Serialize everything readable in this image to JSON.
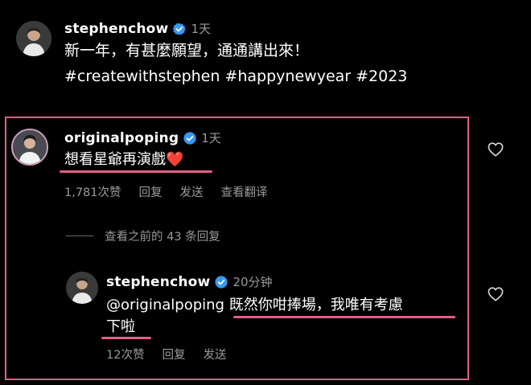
{
  "post": {
    "username": "stephenchow",
    "time": "1天",
    "caption_line1": "新一年，有甚麼願望，通通講出來！",
    "caption_line2": "#createwithstephen #happynewyear #2023"
  },
  "comment": {
    "username": "originalpoping",
    "time": "1天",
    "text": "想看星爺再演戲",
    "emoji": "❤️",
    "likes": "1,781次赞",
    "reply_label": "回复",
    "send_label": "发送",
    "translate_label": "查看翻译",
    "view_previous": "查看之前的 43 条回复"
  },
  "reply": {
    "username": "stephenchow",
    "time": "20分钟",
    "mention": "@originalpoping",
    "text_line1": "既然你咁捧場，我唯有考慮",
    "text_line2": "下啦",
    "likes": "12次赞",
    "reply_label": "回复",
    "send_label": "发送"
  },
  "icons": {
    "verified": "verified-badge-icon",
    "like": "heart-outline-icon"
  },
  "colors": {
    "background": "#000000",
    "highlight": "#e05f8c",
    "verified": "#3897f0",
    "muted": "#9a9a9a"
  }
}
